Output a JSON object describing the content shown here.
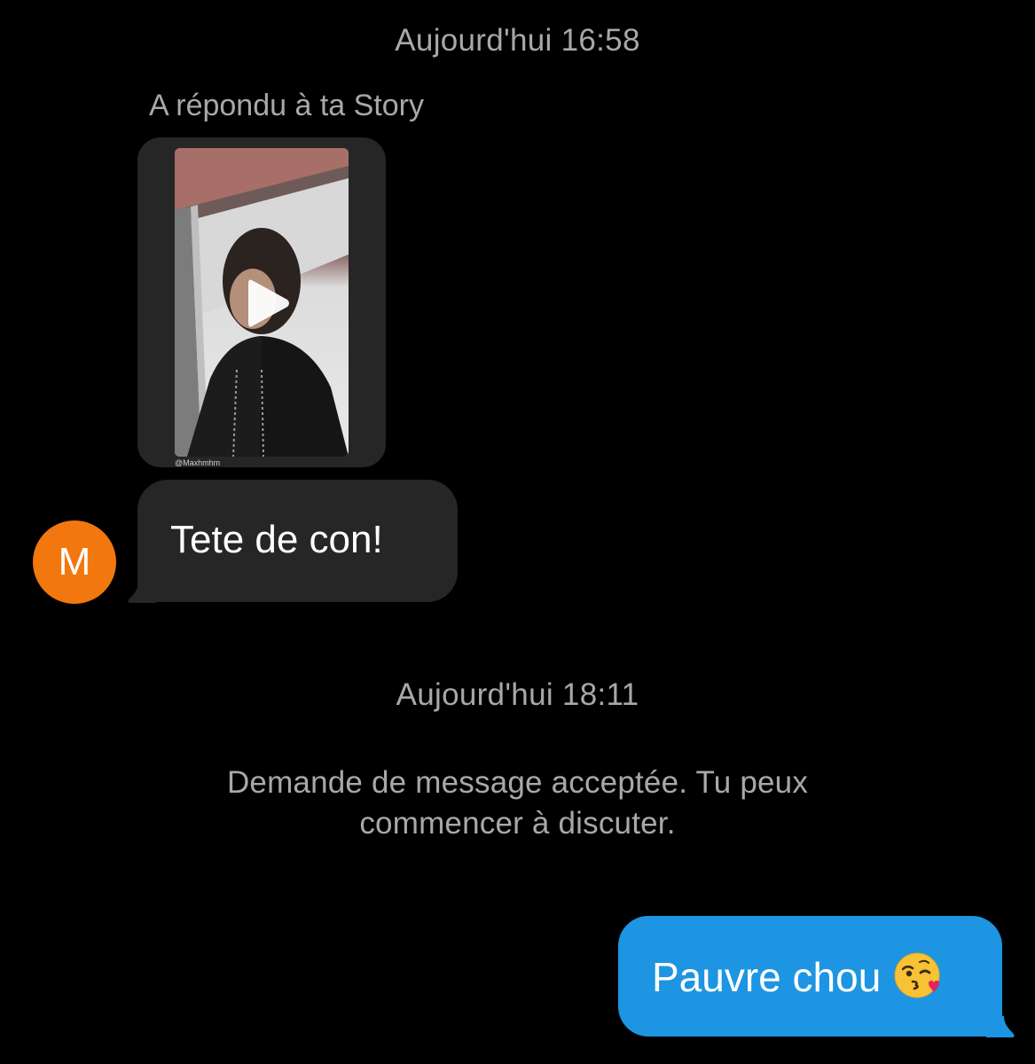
{
  "thread": {
    "timestamp_1": "Aujourd'hui 16:58",
    "reply_label": "A répondu à ta Story",
    "story_credit": "@Maxhmhm",
    "incoming_message": "Tete de con!",
    "sender_initial": "M",
    "timestamp_2": "Aujourd'hui 18:11",
    "system_message_line1": "Demande de message acceptée. Tu peux",
    "system_message_line2": "commencer à discuter.",
    "outgoing_message": "Pauvre chou"
  },
  "icons": {
    "play": "play-icon",
    "emoji": "kissing-heart-emoji"
  },
  "colors": {
    "background": "#000000",
    "incoming_bubble": "#262626",
    "outgoing_bubble": "#1d95e3",
    "avatar": "#f2770e",
    "muted_text": "#a8a8a8"
  }
}
